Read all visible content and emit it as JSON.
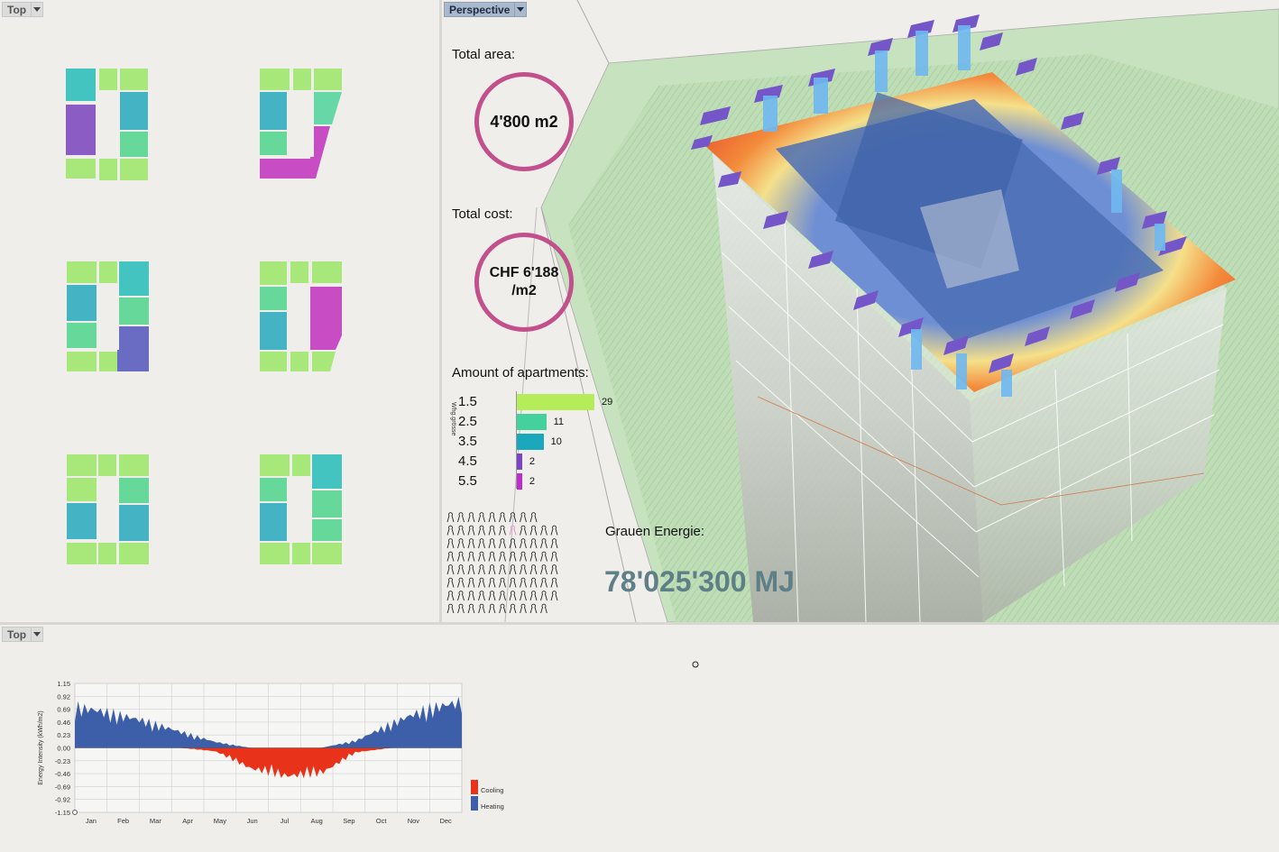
{
  "viewports": {
    "top_left": {
      "label": "Top"
    },
    "perspective": {
      "label": "Perspective"
    },
    "bottom": {
      "label": "Top"
    }
  },
  "metrics": {
    "total_area_label": "Total area:",
    "total_area_value": "4'800 m2",
    "total_cost_label": "Total cost:",
    "total_cost_value_line1": "CHF 6'188",
    "total_cost_value_line2": "/m2",
    "apartments_label": "Amount of apartments:",
    "apartments_axis_label": "Whg.grösse",
    "apartments": [
      {
        "size": "1.5",
        "count": 29,
        "color": "#b4ec5a"
      },
      {
        "size": "2.5",
        "count": 11,
        "color": "#44d19c"
      },
      {
        "size": "3.5",
        "count": 10,
        "color": "#1ba8bc"
      },
      {
        "size": "4.5",
        "count": 2,
        "color": "#7b44c8"
      },
      {
        "size": "5.5",
        "count": 2,
        "color": "#c02ccc"
      }
    ],
    "grey_energy_label": "Grauen Energie:",
    "grey_energy_value": "78'025'300 MJ"
  },
  "chart_data": {
    "type": "area",
    "ylabel": "Energy Intensity (kWh/m2)",
    "y_ticks": [
      "1.15",
      "0.92",
      "0.69",
      "0.46",
      "0.23",
      "0.00",
      "-0.23",
      "-0.46",
      "-0.69",
      "-0.92",
      "-1.15"
    ],
    "ylim": [
      -1.15,
      1.15
    ],
    "categories": [
      "Jan",
      "Feb",
      "Mar",
      "Apr",
      "May",
      "Jun",
      "Jul",
      "Aug",
      "Sep",
      "Oct",
      "Nov",
      "Dec"
    ],
    "grid": true,
    "legend_position": "right-bottom",
    "series": [
      {
        "name": "Cooling",
        "color": "#e8321a",
        "values": [
          0.0,
          0.0,
          0.0,
          0.0,
          -0.07,
          -0.42,
          -0.58,
          -0.52,
          -0.09,
          0.0,
          0.0,
          0.0
        ]
      },
      {
        "name": "Heating",
        "color": "#3d5ea8",
        "values": [
          0.85,
          0.72,
          0.55,
          0.33,
          0.12,
          0.0,
          0.0,
          0.0,
          0.15,
          0.5,
          0.8,
          0.95
        ]
      }
    ]
  },
  "colors": {
    "ring": "#c2508c",
    "energy_value": "#5f7f86"
  }
}
